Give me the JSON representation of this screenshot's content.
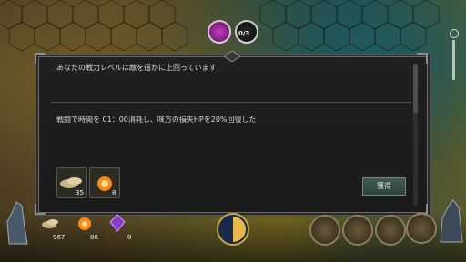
{
  "dialog": {
    "message_top": "あなたの戦力レベルは敵を遥かに上回っています",
    "message_result": "戦闘で時間を 01：00消耗し、味方の損失HPを20%回復した",
    "claim_label": "獲得",
    "rewards": [
      {
        "icon": "bread-icon",
        "count": "35"
      },
      {
        "icon": "fire-orb-icon",
        "count": "8"
      }
    ]
  },
  "top": {
    "counter": "0/3"
  },
  "resources": [
    {
      "icon": "bread-icon",
      "count": "967"
    },
    {
      "icon": "fire-orb-icon",
      "count": "86"
    },
    {
      "icon": "purple-crystal-icon",
      "count": "0"
    }
  ],
  "colors": {
    "panel_bg": "#1e1e1e",
    "button_bg": "#3f5b50",
    "border": "#6b6b6b"
  }
}
